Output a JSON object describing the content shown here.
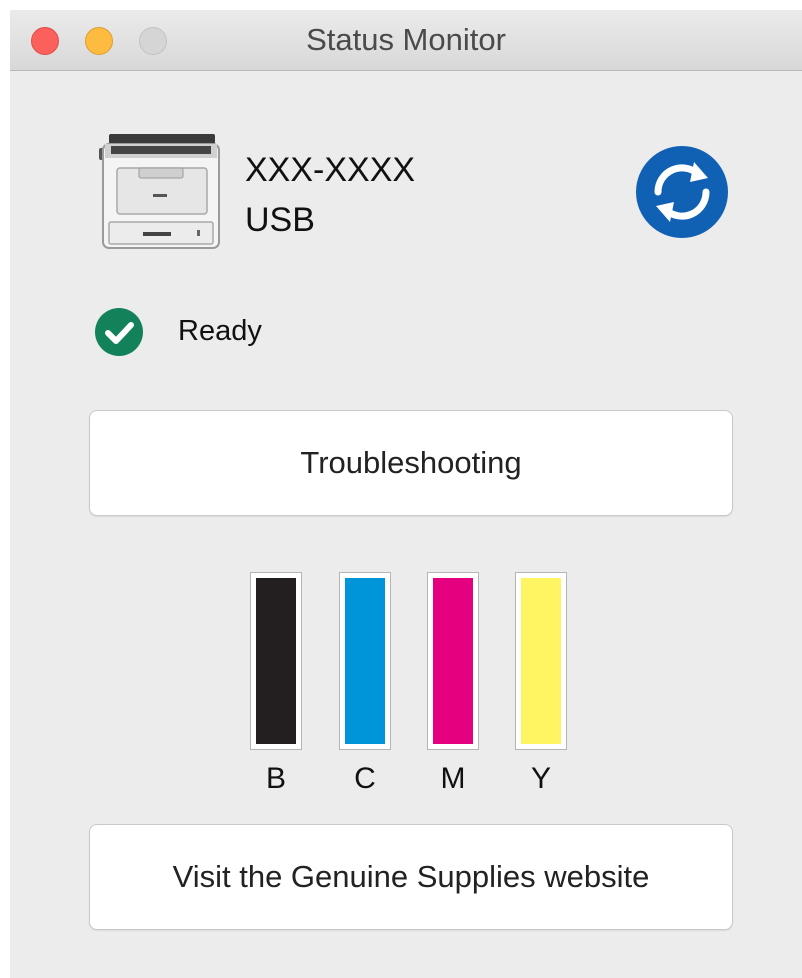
{
  "window": {
    "title": "Status Monitor"
  },
  "device": {
    "name": "XXX-XXXX",
    "connection": "USB",
    "icon": "printer-icon"
  },
  "status": {
    "icon": "checkmark-icon",
    "text": "Ready",
    "color": "#13825a"
  },
  "buttons": {
    "troubleshooting": "Troubleshooting",
    "supplies": "Visit the Genuine Supplies website",
    "refresh_icon": "refresh-icon",
    "refresh_color": "#1060b4"
  },
  "inks": [
    {
      "label": "B",
      "color": "#231f20",
      "level": 1.0
    },
    {
      "label": "C",
      "color": "#0095d9",
      "level": 1.0
    },
    {
      "label": "M",
      "color": "#e4007f",
      "level": 1.0
    },
    {
      "label": "Y",
      "color": "#fff462",
      "level": 1.0
    }
  ]
}
